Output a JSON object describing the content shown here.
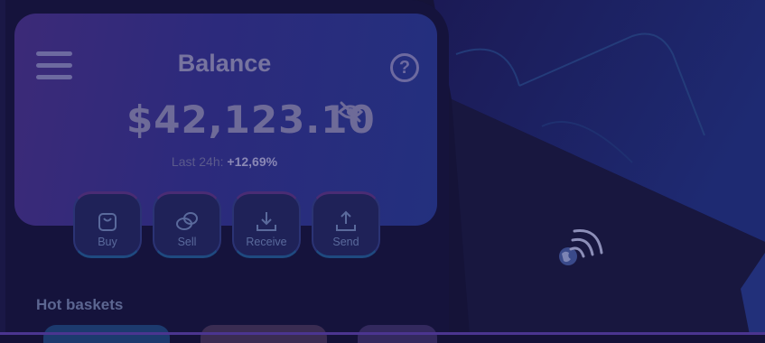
{
  "header": {
    "title": "Balance"
  },
  "balance": {
    "amount": "$42,123.10",
    "change_label": "Last 24h:",
    "change_value": "+12,69%"
  },
  "actions": [
    {
      "label": "Buy",
      "icon": "shopping-bag-icon"
    },
    {
      "label": "Sell",
      "icon": "coins-icon"
    },
    {
      "label": "Receive",
      "icon": "download-icon"
    },
    {
      "label": "Send",
      "icon": "upload-icon"
    }
  ],
  "sections": {
    "hot_baskets": "Hot baskets"
  },
  "icons": {
    "menu": "menu-icon",
    "help": "help-circle-icon",
    "hide_balance": "eye-off-icon",
    "contactless": "nfc-globe-icon"
  },
  "colors": {
    "background": "#141238",
    "card_start": "#3c2a78",
    "card_end": "#23307e",
    "accent_purple": "#4a2c74",
    "accent_blue": "#1f4a80"
  }
}
